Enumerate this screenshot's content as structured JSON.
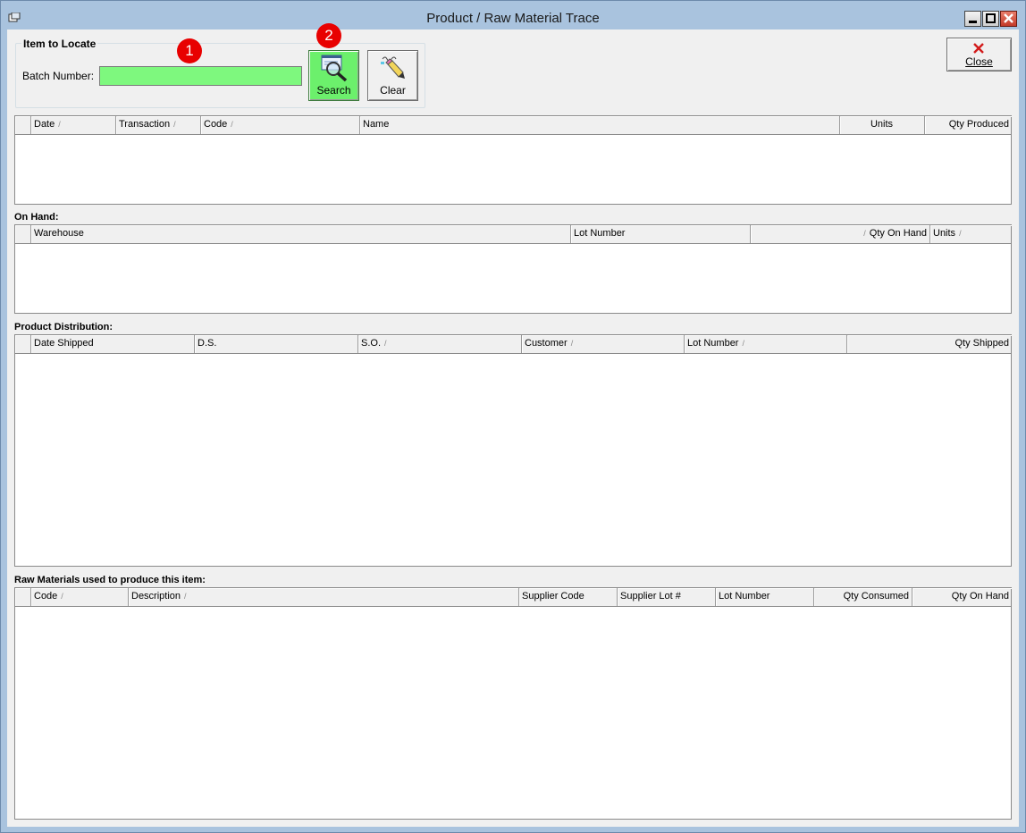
{
  "window": {
    "title": "Product / Raw Material Trace",
    "accent_color": "#a9c3de"
  },
  "locate": {
    "group_title": "Item to Locate",
    "batch_label": "Batch Number:",
    "batch_value": "",
    "input_color": "#7ef87e"
  },
  "toolbar": {
    "search_label": "Search",
    "clear_label": "Clear",
    "close_label": "Close",
    "search_color": "#6cf06c"
  },
  "markers": [
    "1",
    "2"
  ],
  "trace_grid": {
    "columns": [
      {
        "label": "Date",
        "sort": true
      },
      {
        "label": "Transaction",
        "sort": true
      },
      {
        "label": "Code",
        "sort": true
      },
      {
        "label": "Name",
        "sort": false
      },
      {
        "label": "Units",
        "sort": false
      },
      {
        "label": "Qty Produced",
        "sort": false
      }
    ]
  },
  "on_hand": {
    "title": "On Hand:",
    "columns": [
      {
        "label": "Warehouse",
        "sort": false
      },
      {
        "label": "Lot Number",
        "sort": false
      },
      {
        "label": "Qty On Hand",
        "sort": true
      },
      {
        "label": "Units",
        "sort": true
      }
    ]
  },
  "distribution": {
    "title": "Product Distribution:",
    "columns": [
      {
        "label": "Date Shipped",
        "sort": false
      },
      {
        "label": "D.S.",
        "sort": false
      },
      {
        "label": "S.O.",
        "sort": true
      },
      {
        "label": "Customer",
        "sort": true
      },
      {
        "label": "Lot Number",
        "sort": true
      },
      {
        "label": "Qty Shipped",
        "sort": false
      }
    ]
  },
  "raw_materials": {
    "title": "Raw Materials used to produce this item:",
    "columns": [
      {
        "label": "Code",
        "sort": true
      },
      {
        "label": "Description",
        "sort": true
      },
      {
        "label": "Supplier Code",
        "sort": false
      },
      {
        "label": "Supplier Lot #",
        "sort": false
      },
      {
        "label": "Lot Number",
        "sort": false
      },
      {
        "label": "Qty Consumed",
        "sort": false
      },
      {
        "label": "Qty On Hand",
        "sort": false
      }
    ]
  }
}
